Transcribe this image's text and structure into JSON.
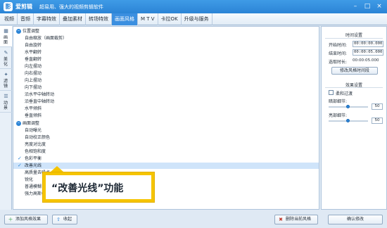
{
  "app": {
    "logo": "影",
    "name": "爱剪辑",
    "slogan": "超易用、强大的视频剪辑软件"
  },
  "window_buttons": [
    "–",
    "□",
    "×"
  ],
  "tabs": [
    {
      "label": "视频"
    },
    {
      "label": "音频"
    },
    {
      "label": "字幕特效"
    },
    {
      "label": "叠加素材"
    },
    {
      "label": "转场特效"
    },
    {
      "label": "画面风格",
      "active": true
    },
    {
      "label": "M T V"
    },
    {
      "label": "卡拉OK"
    },
    {
      "label": "升级与服务"
    }
  ],
  "side_tabs": [
    {
      "label": "画面",
      "icon": "▦",
      "active": true
    },
    {
      "label": "美化",
      "icon": "✎"
    },
    {
      "label": "滤镜",
      "icon": "✦"
    },
    {
      "label": "动景",
      "icon": "☰"
    }
  ],
  "groups": {
    "position": {
      "label": "位置调整",
      "items": [
        "自由缩放（画面裁剪）",
        "自由旋转",
        "水平翻转",
        "垂直翻转",
        "向左摆动",
        "向右摆动",
        "向上摆动",
        "向下摆动",
        "沿水平中轴转动",
        "沿垂直中轴转动",
        "水平倾斜",
        "垂直倾斜"
      ]
    },
    "adjust": {
      "label": "画面调整",
      "items": [
        {
          "label": "自动曝光"
        },
        {
          "label": "自动校正颜色"
        },
        {
          "label": "亮度对比度"
        },
        {
          "label": "色相饱和度"
        },
        {
          "label": "色彩平衡",
          "checked": true
        },
        {
          "label": "改善光线",
          "checked": true,
          "selected": true
        },
        {
          "label": "高质量去噪点"
        },
        {
          "label": "锐化"
        },
        {
          "label": "普通模糊"
        },
        {
          "label": "强力高斯模"
        }
      ]
    }
  },
  "callout": {
    "text": "“改善光线”功能"
  },
  "right_panel": {
    "time_section": {
      "title": "时间设置",
      "start_label": "开始时间:",
      "start_value": "00:00:00.000",
      "end_label": "结束时间:",
      "end_value": "00:00:05.000",
      "duration_label": "选取时长:",
      "duration_value": "00:00:05.000",
      "button": "修改风格时间段"
    },
    "effect_section": {
      "title": "效果设置",
      "soft_label": "柔和过渡",
      "dark_label": "暗部细节:",
      "dark_value": "50",
      "dark_level": 0.5,
      "bright_label": "亮部细节:",
      "bright_value": "50",
      "bright_level": 0.5
    }
  },
  "bottom": {
    "add_label": "添加风格效果",
    "collapse_label": "收起",
    "delete_label": "删除当前风格",
    "confirm_label": "确认修改"
  },
  "colors": {
    "accent": "#2b84d6",
    "callout": "#f5c400",
    "selected_row": "#cfe4fa"
  }
}
